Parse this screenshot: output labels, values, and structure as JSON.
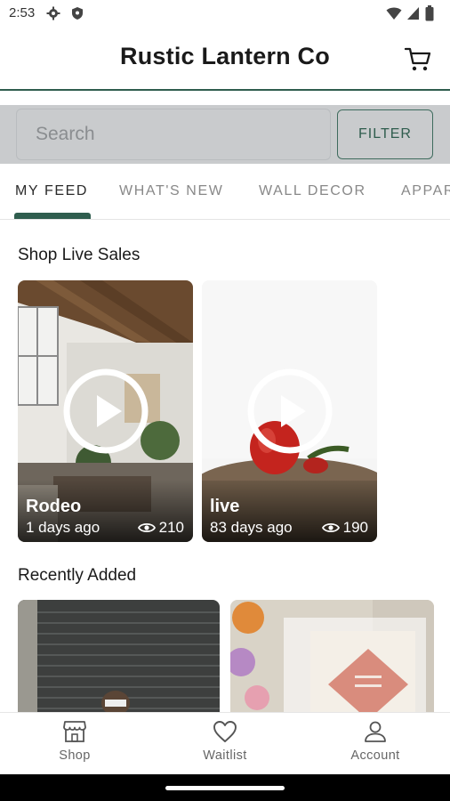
{
  "status_bar": {
    "time": "2:53",
    "icons": [
      "gear-icon",
      "shield-icon",
      "wifi-icon",
      "signal-icon",
      "battery-icon"
    ]
  },
  "header": {
    "title": "Rustic Lantern Co",
    "cart_icon": "cart-icon"
  },
  "search": {
    "placeholder": "Search",
    "value": "",
    "filter_label": "FILTER"
  },
  "tabs": [
    {
      "label": "MY FEED",
      "active": true
    },
    {
      "label": "WHAT'S NEW",
      "active": false
    },
    {
      "label": "WALL DECOR",
      "active": false
    },
    {
      "label": "APPAREL",
      "active": false
    }
  ],
  "live_sales": {
    "title": "Shop Live Sales",
    "cards": [
      {
        "title": "Rodeo",
        "date": "1 days ago",
        "views": "210"
      },
      {
        "title": "live",
        "date": "83 days ago",
        "views": "190"
      }
    ]
  },
  "recently_added": {
    "title": "Recently Added"
  },
  "bottom_nav": [
    {
      "label": "Shop",
      "icon": "storefront-icon"
    },
    {
      "label": "Waitlist",
      "icon": "heart-icon"
    },
    {
      "label": "Account",
      "icon": "person-icon"
    }
  ],
  "colors": {
    "accent": "#2f5d4e",
    "search_band": "#c9cbcd"
  }
}
